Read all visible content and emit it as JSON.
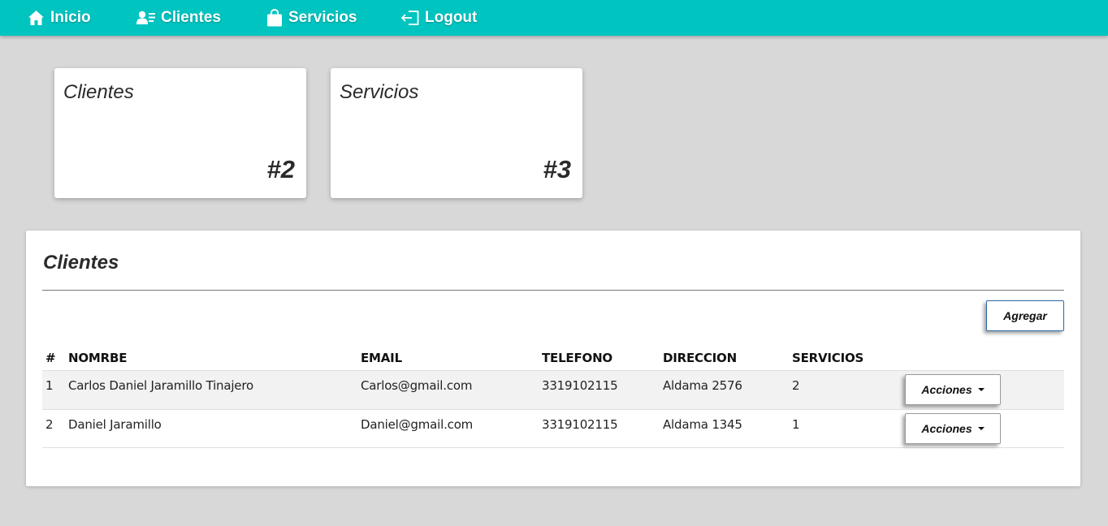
{
  "nav": {
    "items": [
      {
        "label": "Inicio",
        "icon": "home-icon"
      },
      {
        "label": "Clientes",
        "icon": "clients-icon"
      },
      {
        "label": "Servicios",
        "icon": "shopping-bag-icon"
      },
      {
        "label": "Logout",
        "icon": "logout-icon"
      }
    ]
  },
  "cards": [
    {
      "title": "Clientes",
      "count": "#2"
    },
    {
      "title": "Servicios",
      "count": "#3"
    }
  ],
  "panel": {
    "title": "Clientes",
    "add_label": "Agregar"
  },
  "table": {
    "headers": [
      "#",
      "NOMRBE",
      "EMAIL",
      "TELEFONO",
      "DIRECCION",
      "SERVICIOS"
    ],
    "rows": [
      {
        "num": "1",
        "name": "Carlos Daniel Jaramillo Tinajero",
        "email": "Carlos@gmail.com",
        "phone": "3319102115",
        "address": "Aldama 2576",
        "services": "2",
        "action": "Acciones"
      },
      {
        "num": "2",
        "name": "Daniel Jaramillo",
        "email": "Daniel@gmail.com",
        "phone": "3319102115",
        "address": "Aldama 1345",
        "services": "1",
        "action": "Acciones"
      }
    ]
  },
  "colors": {
    "navbar": "#00c4c0",
    "background": "#d8d8d8",
    "card": "#ffffff"
  }
}
